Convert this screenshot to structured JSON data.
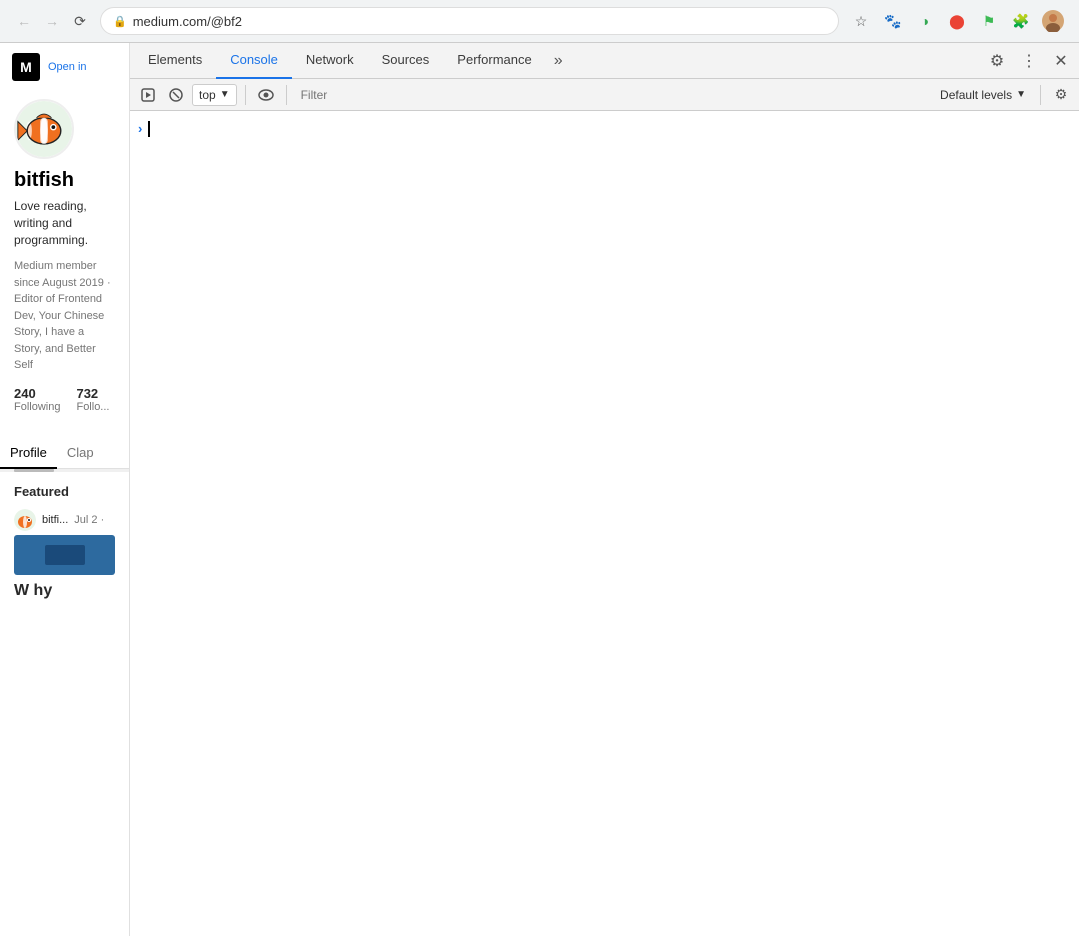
{
  "browser": {
    "url": "medium.com/@bf2",
    "nav": {
      "back_disabled": true,
      "forward_disabled": true
    }
  },
  "medium": {
    "logo": "M",
    "open_label": "Open in",
    "username": "bitfish",
    "bio": "Love reading, writing and programming.",
    "meta": "Medium member since August 2019 · Editor of Frontend Dev, Your Chinese Story, I have a Story, and Better Self",
    "stats": {
      "following_count": "240",
      "following_label": "Following",
      "followers_count": "732",
      "followers_label": "Follo..."
    },
    "tabs": [
      {
        "label": "Profile",
        "active": true
      },
      {
        "label": "Clap",
        "active": false
      }
    ],
    "featured_title": "Featured",
    "article": {
      "author": "bitfi...",
      "date": "Jul 2 ·",
      "title": "W\nhy"
    }
  },
  "devtools": {
    "tabs": [
      {
        "label": "Elements",
        "active": false
      },
      {
        "label": "Console",
        "active": true
      },
      {
        "label": "Network",
        "active": false
      },
      {
        "label": "Sources",
        "active": false
      },
      {
        "label": "Performance",
        "active": false
      }
    ],
    "more_label": "»",
    "context": "top",
    "filter_placeholder": "Filter",
    "levels_label": "Default levels"
  }
}
